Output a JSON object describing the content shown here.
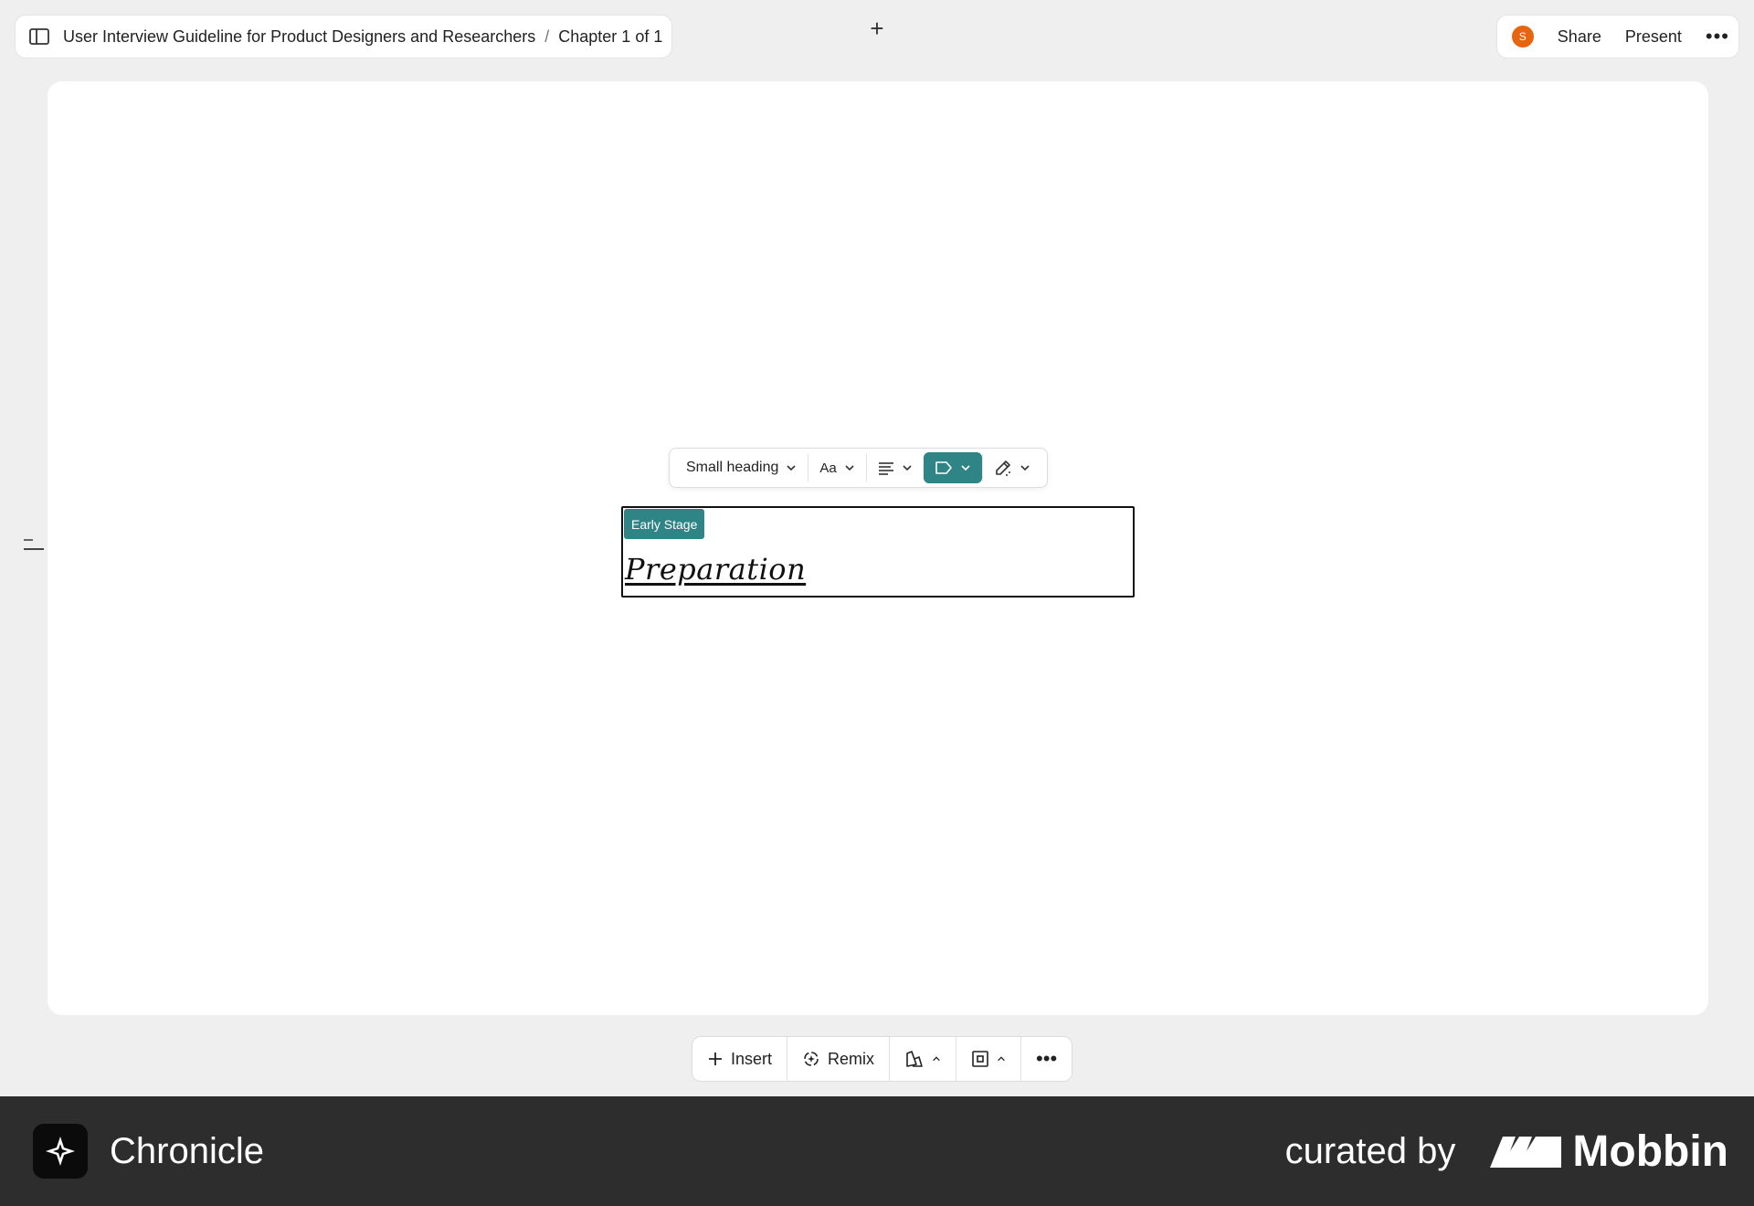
{
  "header": {
    "doc_title": "User Interview Guideline for Product Designers and Researchers",
    "separator": "/",
    "chapter": "Chapter 1 of 1",
    "new_tab_icon": "plus-icon",
    "avatar_initial": "S",
    "share_label": "Share",
    "present_label": "Present"
  },
  "format_toolbar": {
    "text_style": "Small heading",
    "font_label": "Aa",
    "accent_color": "#2f8585"
  },
  "block": {
    "tag_label": "Early Stage",
    "heading": "Preparation"
  },
  "bottom_toolbar": {
    "insert_label": "Insert",
    "remix_label": "Remix"
  },
  "footer": {
    "brand": "Chronicle",
    "curated_by": "curated by",
    "curator": "Mobbin"
  }
}
